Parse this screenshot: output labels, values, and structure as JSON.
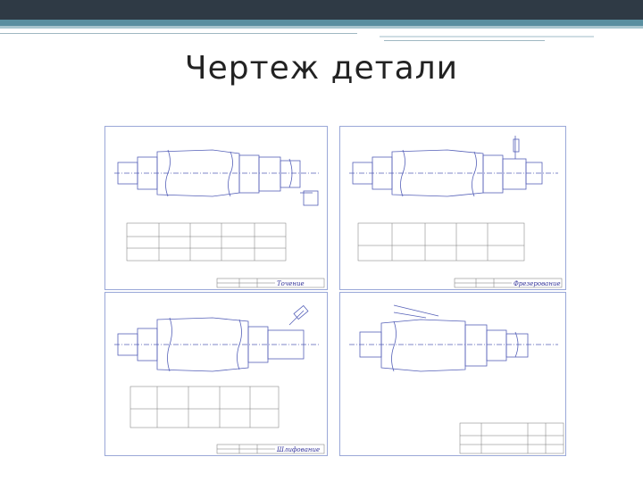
{
  "slide": {
    "title": "Чертеж детали"
  },
  "sheets": [
    {
      "id": "top-left",
      "stamp": "Точение"
    },
    {
      "id": "top-right",
      "stamp": "Фрезерование"
    },
    {
      "id": "bottom-left",
      "stamp": "Шлифование"
    },
    {
      "id": "bottom-right",
      "stamp": ""
    }
  ]
}
